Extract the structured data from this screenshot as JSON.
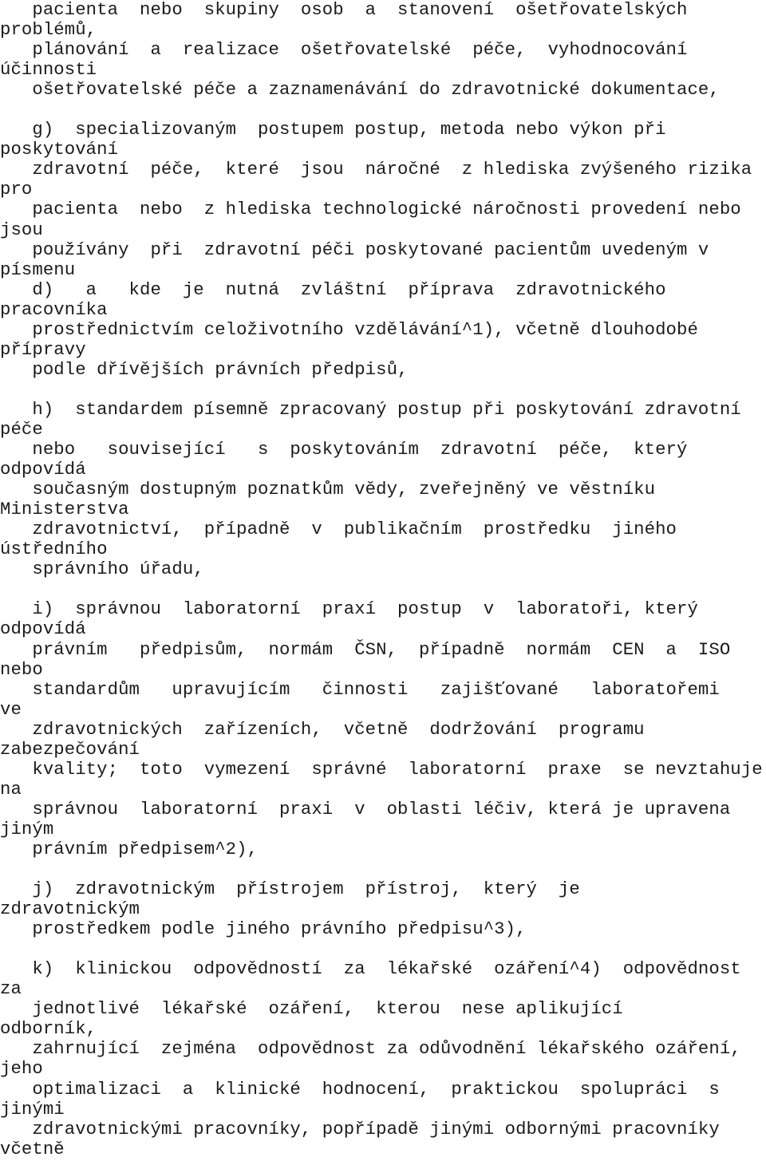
{
  "document": {
    "kind": "plain-text-legal-document",
    "language": "cs",
    "font_color": "#1b1b1b",
    "background_color": "#ffffff",
    "lines": [
      "   pacienta  nebo  skupiny  osob  a  stanovení  ošetřovatelských",
      "problémů,",
      "   plánování  a  realizace  ošetřovatelské  péče,  vyhodnocování",
      "účinnosti",
      "   ošetřovatelské péče a zaznamenávání do zdravotnické dokumentace,",
      "",
      "   g)  specializovaným  postupem postup, metoda nebo výkon při",
      "poskytování",
      "   zdravotní  péče,  které  jsou  náročné  z hlediska zvýšeného rizika",
      "pro",
      "   pacienta  nebo  z hlediska technologické náročnosti provedení nebo",
      "jsou",
      "   používány  při  zdravotní péči poskytované pacientům uvedeným v",
      "písmenu",
      "   d)   a   kde  je  nutná  zvláštní  příprava  zdravotnického",
      "pracovníka",
      "   prostřednictvím celoživotního vzdělávání^1), včetně dlouhodobé",
      "přípravy",
      "   podle dřívějších právních předpisů,",
      "",
      "   h)  standardem písemně zpracovaný postup při poskytování zdravotní",
      "péče",
      "   nebo   související   s  poskytováním  zdravotní  péče,  který",
      "odpovídá",
      "   současným dostupným poznatkům vědy, zveřejněný ve věstníku",
      "Ministerstva",
      "   zdravotnictví,  případně  v  publikačním  prostředku  jiného",
      "ústředního",
      "   správního úřadu,",
      "",
      "   i)  správnou  laboratorní  praxí  postup  v  laboratoři, který",
      "odpovídá",
      "   právním   předpisům,  normám  ČSN,  případně  normám  CEN  a  ISO",
      "nebo",
      "   standardům   upravujícím   činnosti   zajišťované   laboratořemi",
      "ve",
      "   zdravotnických  zařízeních,  včetně  dodržování  programu",
      "zabezpečování",
      "   kvality;  toto  vymezení  správné  laboratorní  praxe  se nevztahuje",
      "na",
      "   správnou  laboratorní  praxi  v  oblasti léčiv, která je upravena",
      "jiným",
      "   právním předpisem^2),",
      "",
      "   j)  zdravotnickým  přístrojem  přístroj,  který  je",
      "zdravotnickým",
      "   prostředkem podle jiného právního předpisu^3),",
      "",
      "   k)  klinickou  odpovědností  za  lékařské  ozáření^4)  odpovědnost",
      "za",
      "   jednotlivé  lékařské  ozáření,  kterou  nese aplikující",
      "odborník,",
      "   zahrnující  zejména  odpovědnost za odůvodnění lékařského ozáření,",
      "jeho",
      "   optimalizaci  a  klinické  hodnocení,  praktickou  spolupráci  s",
      "jinými",
      "   zdravotnickými pracovníky, popřípadě jinými odbornými pracovníky",
      "včetně"
    ]
  }
}
